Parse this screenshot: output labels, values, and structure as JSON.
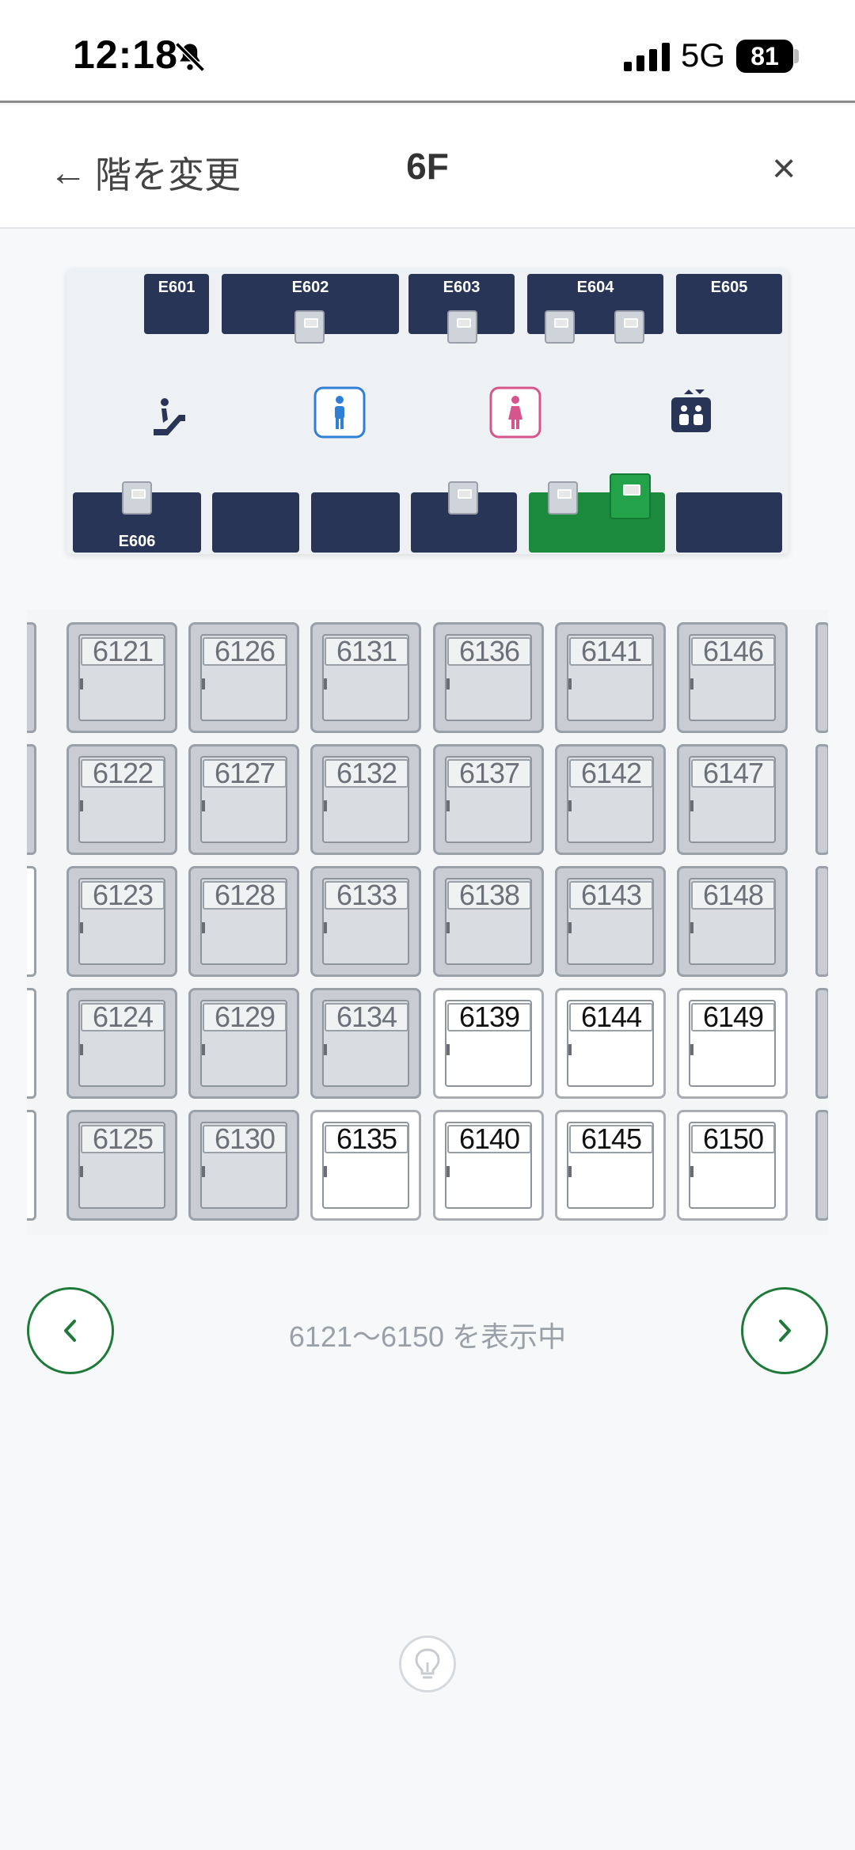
{
  "status": {
    "time": "12:18",
    "network": "5G",
    "battery": "81"
  },
  "header": {
    "back_arrow": "←",
    "back_label": "階を変更",
    "floor": "6F",
    "close": "×"
  },
  "floormap": {
    "rooms_top": [
      "E601",
      "E602",
      "E603",
      "E604",
      "E605"
    ],
    "room_bottom_labeled": "E606",
    "facilities": [
      "escalator-icon",
      "mens-restroom-icon",
      "womens-restroom-icon",
      "elevator-icon"
    ],
    "colors": {
      "room": "#283556",
      "active": "#1c8a3c",
      "men": "#2f7fd6",
      "women": "#d6558c"
    }
  },
  "lockers": [
    {
      "num": "6121",
      "available": false
    },
    {
      "num": "6126",
      "available": false
    },
    {
      "num": "6131",
      "available": false
    },
    {
      "num": "6136",
      "available": false
    },
    {
      "num": "6141",
      "available": false
    },
    {
      "num": "6146",
      "available": false
    },
    {
      "num": "6122",
      "available": false
    },
    {
      "num": "6127",
      "available": false
    },
    {
      "num": "6132",
      "available": false
    },
    {
      "num": "6137",
      "available": false
    },
    {
      "num": "6142",
      "available": false
    },
    {
      "num": "6147",
      "available": false
    },
    {
      "num": "6123",
      "available": false
    },
    {
      "num": "6128",
      "available": false
    },
    {
      "num": "6133",
      "available": false
    },
    {
      "num": "6138",
      "available": false
    },
    {
      "num": "6143",
      "available": false
    },
    {
      "num": "6148",
      "available": false
    },
    {
      "num": "6124",
      "available": false
    },
    {
      "num": "6129",
      "available": false
    },
    {
      "num": "6134",
      "available": false
    },
    {
      "num": "6139",
      "available": true
    },
    {
      "num": "6144",
      "available": true
    },
    {
      "num": "6149",
      "available": true
    },
    {
      "num": "6125",
      "available": false
    },
    {
      "num": "6130",
      "available": false
    },
    {
      "num": "6135",
      "available": true
    },
    {
      "num": "6140",
      "available": true
    },
    {
      "num": "6145",
      "available": true
    },
    {
      "num": "6150",
      "available": true
    }
  ],
  "pagination": {
    "info": "6121〜6150 を表示中"
  },
  "accent": "#1f7a3a"
}
